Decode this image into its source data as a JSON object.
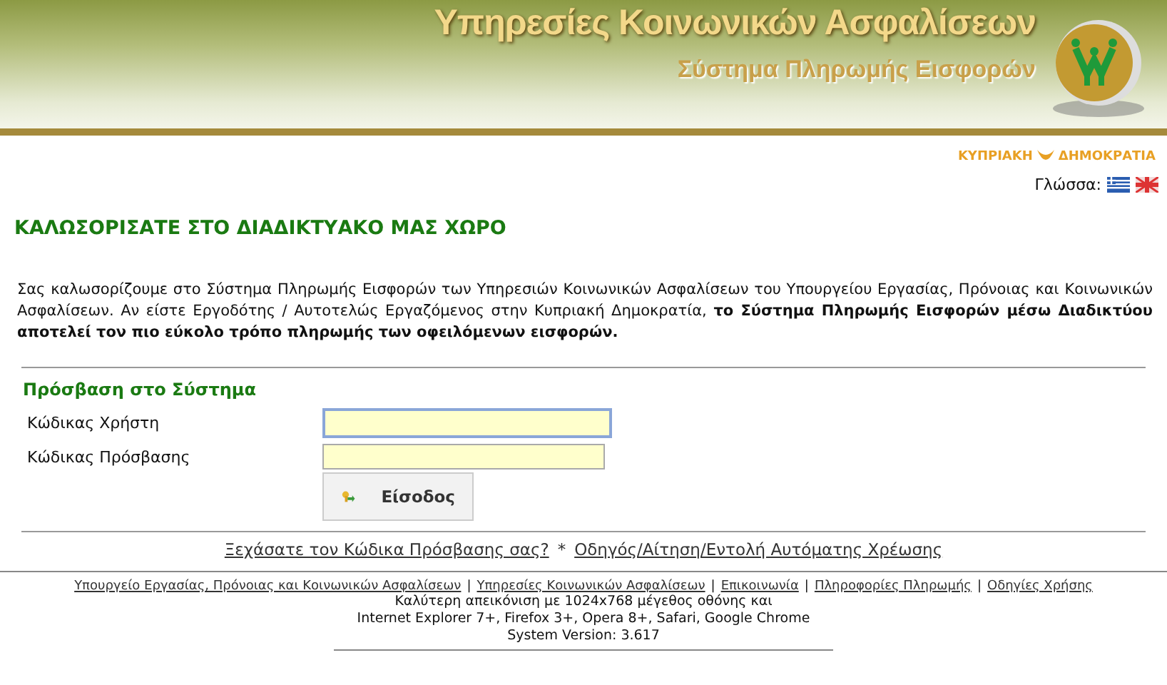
{
  "header": {
    "title": "Υπηρεσίες Κοινωνικών Ασφαλίσεων",
    "subtitle": "Σύστημα Πληρωμής Εισφορών"
  },
  "government": {
    "left": "ΚΥΠΡΙΑΚΗ",
    "right": "ΔΗΜΟΚΡΑΤΙΑ"
  },
  "language": {
    "label": "Γλώσσα:"
  },
  "welcome": {
    "heading": "ΚΑΛΩΣΟΡΙΣΑΤΕ ΣΤΟ ΔΙΑΔΙΚΤΥΑΚΟ ΜΑΣ ΧΩΡΟ",
    "text": "Σας καλωσορίζουμε στο Σύστημα Πληρωμής Εισφορών των Υπηρεσιών Κοινωνικών Ασφαλίσεων του Υπουργείου Εργασίας, Πρόνοιας και Κοινωνικών Ασφαλίσεων. Αν είστε Εργοδότης / Αυτοτελώς Εργαζόμενος στην Κυπριακή Δημοκρατία, **το Σύστημα Πληρωμής Εισφορών μέσω Διαδικτύου αποτελεί τον πιο εύκολο τρόπο πληρωμής των οφειλόμενων εισφορών.**"
  },
  "login": {
    "heading": "Πρόσβαση στο Σύστημα",
    "fields": [
      {
        "label": "Κώδικας Χρήστη",
        "focused": true
      },
      {
        "label": "Κώδικας Πρόσβασης",
        "focused": false
      }
    ],
    "button": "Είσοδος"
  },
  "help_links": {
    "items": [
      "Ξεχάσατε τον Κώδικα Πρόσβασης σας?",
      "Οδηγός/Αίτηση/Εντολή Αυτόματης Χρέωσης"
    ],
    "separator": "*"
  },
  "footer": {
    "links": [
      "Υπουργείο Εργασίας, Πρόνοιας και Κοινωνικών Ασφαλίσεων",
      "Υπηρεσίες Κοινωνικών Ασφαλίσεων",
      "Επικοινωνία",
      "Πληροφορίες Πληρωμής",
      "Οδηγίες Χρήσης"
    ],
    "separator": "|",
    "lines": [
      "Καλύτερη απεικόνιση με 1024x768 μέγεθος οθόνης και",
      "Internet Explorer 7+, Firefox 3+, Opera 8+, Safari, Google Chrome",
      "System Version: 3.617"
    ]
  }
}
